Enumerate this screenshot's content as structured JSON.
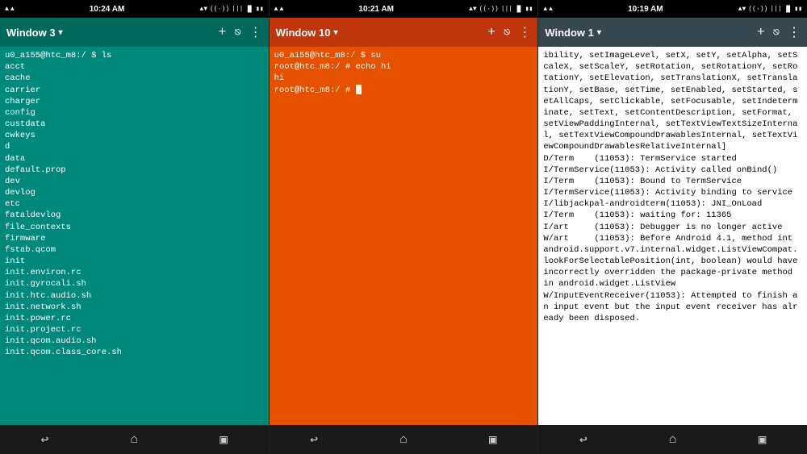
{
  "panels": [
    {
      "id": "window3",
      "status": {
        "time": "10:24 AM",
        "left_icons": [
          "▲",
          "▲"
        ],
        "right_icons": [
          "▲▼",
          "((·))",
          "|||",
          "▐▌",
          "▮▮"
        ]
      },
      "titlebar": {
        "label": "Window 3",
        "chevron": "▾",
        "icon_plus": "+",
        "icon_share": "⬡",
        "icon_more": "⋮"
      },
      "theme": "green",
      "content": "u0_a155@htc_m8:/ $ ls\nacct\ncache\ncarrier\ncharger\nconfig\ncustdata\ncwkeys\nd\ndata\ndefault.prop\ndev\ndevlog\netc\nfataldevlog\nfile_contexts\nfirmware\nfstab.qcom\ninit\ninit.environ.rc\ninit.gyrocali.sh\ninit.htc.audio.sh\ninit.network.sh\ninit.power.rc\ninit.project.rc\ninit.qcom.audio.sh\ninit.qcom.class_core.sh",
      "nav": [
        "↩",
        "⌂",
        "▣"
      ]
    },
    {
      "id": "window10",
      "status": {
        "time": "10:21 AM",
        "left_icons": [
          "▲",
          "▲"
        ],
        "right_icons": [
          "▲▼",
          "((·))",
          "|||",
          "▐▌",
          "▮▮"
        ]
      },
      "titlebar": {
        "label": "Window 10",
        "chevron": "▾",
        "icon_plus": "+",
        "icon_share": "⬡",
        "icon_more": "⋮"
      },
      "theme": "orange",
      "content": "u0_a155@htc_m8:/ $ su\nroot@htc_m8:/ # echo hi\nhi\nroot@htc_m8:/ # ",
      "has_cursor": true,
      "nav": [
        "↩",
        "⌂",
        "▣"
      ]
    },
    {
      "id": "window1",
      "status": {
        "time": "10:19 AM",
        "left_icons": [
          "▲",
          "▲"
        ],
        "right_icons": [
          "▲▼",
          "((·))",
          "|||",
          "▐▌",
          "▮▮"
        ]
      },
      "titlebar": {
        "label": "Window 1",
        "chevron": "▾",
        "icon_plus": "+",
        "icon_share": "⬡",
        "icon_more": "⋮"
      },
      "theme": "white",
      "content": "ibility, setImageLevel, setX, setY, setAlpha, setScaleX, setScaleY, setRotation, setRotationY, setRotationY, setElevation, setTranslationX, setTranslationY, setBase, setTime, setEnabled, setStarted, setAllCaps, setClickable, setFocusable, setIndeterminate, setText, setContentDescription, setFormat, setViewPaddingInternal, setTextViewTextSizeInternal, setTextViewCompoundDrawablesInternal, setTextViewCompoundDrawablesRelativeInternal]\nD/Term    (11053): TermService started\nI/TermService(11053): Activity called onBind()\nI/Term    (11053): Bound to TermService\nI/TermService(11053): Activity binding to service\nI/libjackpal-androidterm(11053): JNI_OnLoad\nI/Term    (11053): waiting for: 11365\nI/art     (11053): Debugger is no longer active\nW/art     (11053): Before Android 4.1, method int android.support.v7.internal.widget.ListViewCompat.lookForSelectablePosition(int, boolean) would have incorrectly overridden the package-private method in android.widget.ListView\nW/InputEventReceiver(11053): Attempted to finish an input event but the input event receiver has already been disposed.",
      "nav": [
        "↩",
        "⌂",
        "▣"
      ]
    }
  ]
}
